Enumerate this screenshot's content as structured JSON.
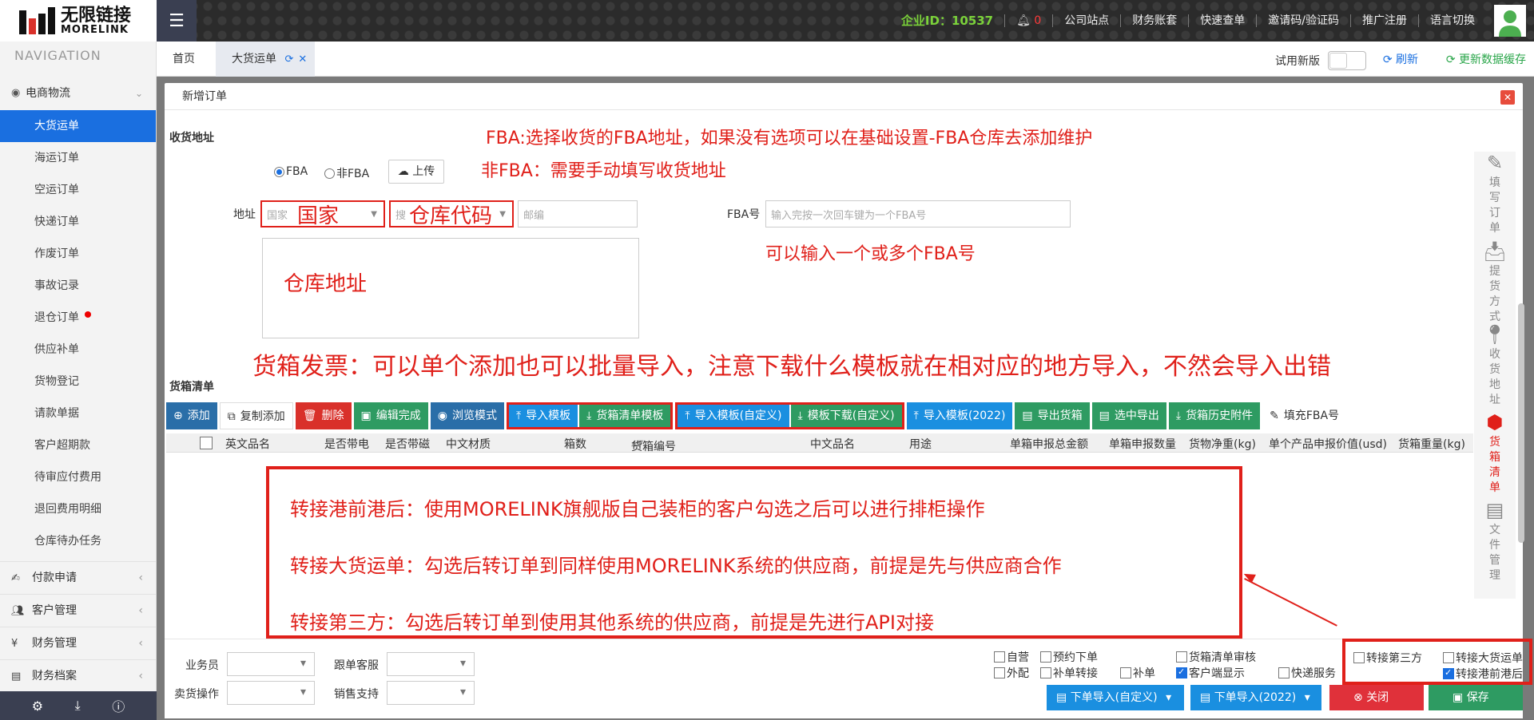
{
  "header": {
    "logo_cn": "无限链接",
    "logo_en": "MORELINK",
    "enterprise_id": "企业ID：10537",
    "bell_count": "0",
    "nav": [
      "公司站点",
      "财务账套",
      "快速查单",
      "邀请码/验证码",
      "推广注册",
      "语言切换"
    ]
  },
  "sidebar": {
    "title": "NAVIGATION",
    "group_main": "电商物流",
    "items": [
      "大货运单",
      "海运订单",
      "空运订单",
      "快递订单",
      "作废订单",
      "事故记录",
      "退仓订单",
      "供应补单",
      "货物登记",
      "请款单据",
      "客户超期款",
      "待审应付费用",
      "退回费用明细",
      "仓库待办任务"
    ],
    "groups": [
      "付款申请",
      "客户管理",
      "财务管理",
      "财务档案"
    ]
  },
  "tabs": {
    "home": "首页",
    "active": "大货运单",
    "try_new": "试用新版",
    "refresh": "刷新",
    "update_cache": "更新数据缓存"
  },
  "modal": {
    "title": "新增订单",
    "section_address": "收货地址",
    "section_goods": "货箱清单",
    "note_fba": "FBA:选择收货的FBA地址，如果没有选项可以在基础设置-FBA仓库去添加维护",
    "note_nonfba": "非FBA：需要手动填写收货地址",
    "radio_fba": "FBA",
    "radio_nonfba": "非FBA",
    "upload": "上传",
    "address_label": "地址",
    "country_placeholder": "国家",
    "country_note": "国家",
    "search_placeholder": "搜",
    "warehouse_note": "仓库代码",
    "postcode_placeholder": "邮编",
    "fba_label": "FBA号",
    "fba_placeholder": "输入完按一次回车键为一个FBA号",
    "fba_note": "可以输入一个或多个FBA号",
    "warehouse_address_note": "仓库地址",
    "goods_note": "货箱发票：可以单个添加也可以批量导入，注意下载什么模板就在相对应的地方导入，不然会导入出错"
  },
  "toolbar": {
    "add": "添加",
    "copy_add": "复制添加",
    "delete": "删除",
    "edit_done": "编辑完成",
    "browse": "浏览模式",
    "import_tpl": "导入模板",
    "box_list_tpl": "货箱清单模板",
    "import_custom": "导入模板(自定义)",
    "download_custom": "模板下载(自定义)",
    "import_2022": "导入模板(2022)",
    "export_boxes": "导出货箱",
    "export_selected": "选中导出",
    "box_history": "货箱历史附件",
    "fill_fba": "填充FBA号"
  },
  "table_headers": [
    "英文品名",
    "是否带电",
    "是否带磁",
    "中文材质",
    "箱数",
    "货箱编号",
    "中文品名",
    "用途",
    "单箱申报总金额",
    "单箱申报数量",
    "货物净重(kg)",
    "单个产品申报价值(usd)",
    "货箱重量(kg)"
  ],
  "box_notes": [
    "转接港前港后：使用MORELINK旗舰版自己装柜的客户勾选之后可以进行排柜操作",
    "转接大货运单：勾选后转订单到同样使用MORELINK系统的供应商，前提是先与供应商合作",
    "转接第三方：勾选后转订单到使用其他系统的供应商，前提是先进行API对接"
  ],
  "right_panel": [
    "填写订单",
    "提货方式",
    "收货地址",
    "货箱清单",
    "文件管理"
  ],
  "bottom": {
    "salesman": "业务员",
    "follow_cs": "跟单客服",
    "sell_op": "卖货操作",
    "sales_support": "销售支持",
    "checks": [
      {
        "label": "自营",
        "checked": false
      },
      {
        "label": "预约下单",
        "checked": false
      },
      {
        "label": "货箱清单审核",
        "checked": false
      },
      {
        "label": "外配",
        "checked": false
      },
      {
        "label": "补单转接",
        "checked": false
      },
      {
        "label": "补单",
        "checked": false
      },
      {
        "label": "客户端显示",
        "checked": true
      },
      {
        "label": "快递服务",
        "checked": false
      }
    ],
    "transfer_third": "转接第三方",
    "transfer_bulk": "转接大货运单",
    "transfer_port": "转接港前港后",
    "order_import_custom": "下单导入(自定义)",
    "order_import_2022": "下单导入(2022)",
    "close": "关闭",
    "save": "保存"
  },
  "colors": {
    "accent": "#1a6fe0",
    "annotation_red": "#e0201a",
    "green": "#2e9b62"
  }
}
